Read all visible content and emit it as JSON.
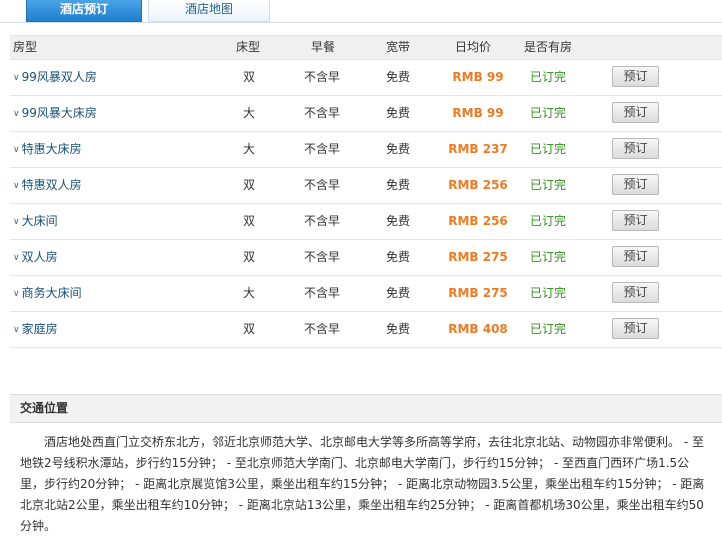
{
  "tabs": [
    {
      "label": "酒店预订",
      "active": true
    },
    {
      "label": "酒店地图",
      "active": false
    }
  ],
  "table": {
    "headers": {
      "room_type": "房型",
      "bed_type": "床型",
      "breakfast": "早餐",
      "broadband": "宽带",
      "daily_price": "日均价",
      "availability": "是否有房"
    },
    "book_label": "预订",
    "rows": [
      {
        "name": "99风暴双人房",
        "bed": "双",
        "breakfast": "不含早",
        "broadband": "免费",
        "price": "RMB 99",
        "status": "已订完"
      },
      {
        "name": "99风暴大床房",
        "bed": "大",
        "breakfast": "不含早",
        "broadband": "免费",
        "price": "RMB 99",
        "status": "已订完"
      },
      {
        "name": "特惠大床房",
        "bed": "大",
        "breakfast": "不含早",
        "broadband": "免费",
        "price": "RMB 237",
        "status": "已订完"
      },
      {
        "name": "特惠双人房",
        "bed": "双",
        "breakfast": "不含早",
        "broadband": "免费",
        "price": "RMB 256",
        "status": "已订完"
      },
      {
        "name": "大床间",
        "bed": "双",
        "breakfast": "不含早",
        "broadband": "免费",
        "price": "RMB 256",
        "status": "已订完"
      },
      {
        "name": "双人房",
        "bed": "双",
        "breakfast": "不含早",
        "broadband": "免费",
        "price": "RMB 275",
        "status": "已订完"
      },
      {
        "name": "商务大床间",
        "bed": "大",
        "breakfast": "不含早",
        "broadband": "免费",
        "price": "RMB 275",
        "status": "已订完"
      },
      {
        "name": "家庭房",
        "bed": "双",
        "breakfast": "不含早",
        "broadband": "免费",
        "price": "RMB 408",
        "status": "已订完"
      }
    ]
  },
  "traffic": {
    "title": "交通位置",
    "text": "酒店地处西直门立交桥东北方，邻近北京师范大学、北京邮电大学等多所高等学府，去往北京北站、动物园亦非常便利。 - 至地铁2号线积水潭站，步行约15分钟； - 至北京师范大学南门、北京邮电大学南门，步行约15分钟； - 至西直门西环广场1.5公里，步行约20分钟； - 距离北京展览馆3公里，乘坐出租车约15分钟； - 距离北京动物园3.5公里，乘坐出租车约15分钟； - 距离北京北站2公里，乘坐出租车约10分钟； - 距离北京站13公里，乘坐出租车约25分钟； - 距离首都机场30公里，乘坐出租车约50分钟。"
  },
  "colors": {
    "tab_active": "#1f7fcf",
    "room_name": "#1a5276",
    "price": "#ee7a21",
    "status": "#2f8f1b"
  }
}
